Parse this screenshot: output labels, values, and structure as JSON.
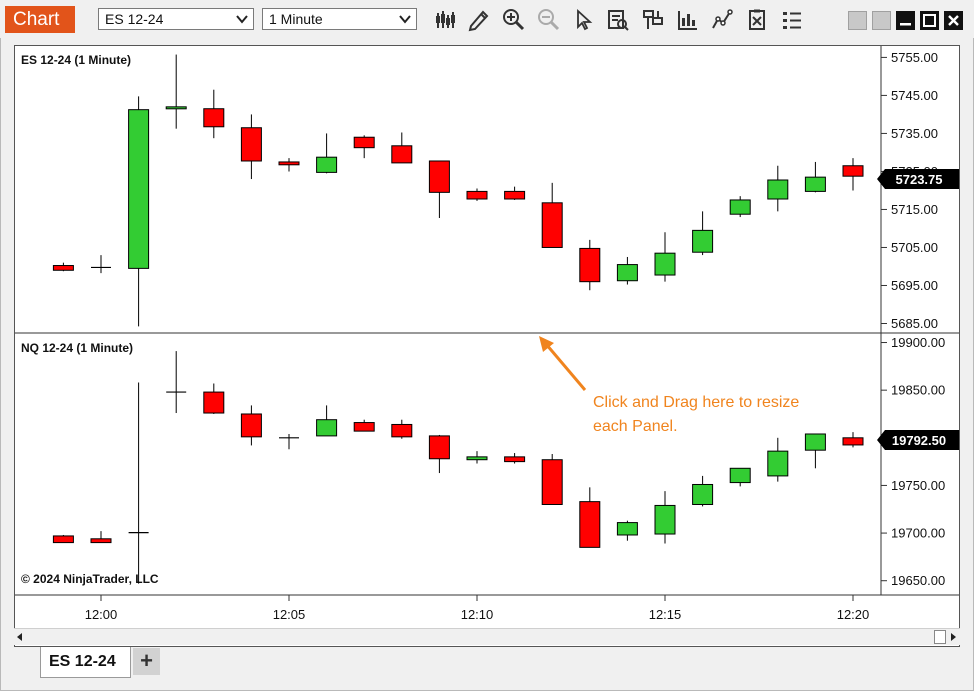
{
  "window": {
    "title": "Chart",
    "instrument": "ES 12-24",
    "interval": "1 Minute",
    "accent": "#e2541a"
  },
  "toolbar": {
    "icons": [
      "bars-type-icon",
      "draw-pencil-icon",
      "zoom-in-icon",
      "zoom-out-icon",
      "pointer-icon",
      "data-box-icon",
      "chart-trader-icon",
      "indicators-icon",
      "strategies-icon",
      "templates-icon",
      "properties-icon"
    ]
  },
  "panels": [
    {
      "label": "ES 12-24 (1 Minute)",
      "price_marker": "5723.75",
      "ticks": [
        "5755.00",
        "5745.00",
        "5735.00",
        "5725.00",
        "5715.00",
        "5705.00",
        "5695.00",
        "5685.00"
      ]
    },
    {
      "label": "NQ 12-24 (1 Minute)",
      "price_marker": "19792.50",
      "ticks": [
        "19900.00",
        "19850.00",
        "19800.00",
        "19750.00",
        "19700.00",
        "19650.00"
      ]
    }
  ],
  "copyright": "© 2024 NinjaTrader, LLC",
  "annotation": {
    "line1": "Click and Drag here to resize",
    "line2": "each Panel.",
    "color": "#f0841e"
  },
  "time_axis": [
    "12:00",
    "12:05",
    "12:10",
    "12:15",
    "12:20"
  ],
  "tabs": {
    "active": "ES 12-24",
    "add": "+"
  },
  "colors": {
    "up": "#33cc33",
    "down": "#ff0000",
    "marker_bg": "#000000"
  },
  "chart_data": [
    {
      "type": "candlestick",
      "title": "ES 12-24 (1 Minute)",
      "x": [
        "11:59",
        "12:00",
        "12:01",
        "12:02",
        "12:03",
        "12:04",
        "12:05",
        "12:06",
        "12:07",
        "12:08",
        "12:09",
        "12:10",
        "12:11",
        "12:12",
        "12:13",
        "12:14",
        "12:15",
        "12:16",
        "12:17",
        "12:18",
        "12:19",
        "12:20"
      ],
      "open": [
        5700.25,
        5699.75,
        5699.5,
        5741.5,
        5741.5,
        5736.5,
        5727.5,
        5724.75,
        5734.0,
        5731.75,
        5727.75,
        5719.75,
        5719.75,
        5716.75,
        5704.75,
        5696.25,
        5697.75,
        5703.75,
        5713.75,
        5717.75,
        5719.75,
        5726.5
      ],
      "high": [
        5701.0,
        5703.0,
        5744.75,
        5755.75,
        5746.5,
        5740.0,
        5728.5,
        5735.0,
        5734.5,
        5735.25,
        5727.75,
        5720.5,
        5721.0,
        5722.0,
        5707.0,
        5702.5,
        5709.0,
        5714.5,
        5718.5,
        5726.5,
        5727.5,
        5728.5
      ],
      "low": [
        5698.75,
        5698.25,
        5684.25,
        5736.25,
        5733.75,
        5723.0,
        5725.0,
        5724.5,
        5728.5,
        5728.0,
        5712.75,
        5717.25,
        5717.5,
        5706.75,
        5693.75,
        5695.25,
        5696.0,
        5703.0,
        5713.0,
        5714.5,
        5719.5,
        5720.0
      ],
      "close": [
        5699.0,
        5699.75,
        5741.25,
        5742.0,
        5736.75,
        5727.75,
        5726.75,
        5728.75,
        5731.25,
        5727.25,
        5719.5,
        5717.75,
        5717.75,
        5705.0,
        5696.0,
        5700.5,
        5703.5,
        5709.5,
        5717.5,
        5722.75,
        5723.5,
        5723.75
      ],
      "ylim": [
        5682.5,
        5758.0
      ]
    },
    {
      "type": "candlestick",
      "title": "NQ 12-24 (1 Minute)",
      "x": [
        "11:59",
        "12:00",
        "12:01",
        "12:02",
        "12:03",
        "12:04",
        "12:05",
        "12:06",
        "12:07",
        "12:08",
        "12:09",
        "12:10",
        "12:11",
        "12:12",
        "12:13",
        "12:14",
        "12:15",
        "12:16",
        "12:17",
        "12:18",
        "12:19",
        "12:20"
      ],
      "open": [
        19697.0,
        19694.0,
        19700.5,
        19848.0,
        19848.0,
        19825.0,
        19800.0,
        19802.0,
        19816.0,
        19814.0,
        19802.0,
        19777.0,
        19780.0,
        19777.0,
        19733.0,
        19698.0,
        19699.0,
        19730.0,
        19753.0,
        19760.0,
        19787.0,
        19800.0
      ],
      "high": [
        19698.0,
        19702.0,
        19858.0,
        19891.0,
        19857.0,
        19834.0,
        19804.0,
        19834.0,
        19819.0,
        19819.0,
        19803.0,
        19786.0,
        19784.0,
        19783.0,
        19748.0,
        19713.0,
        19744.0,
        19760.0,
        19768.0,
        19800.0,
        19804.0,
        19806.0
      ],
      "low": [
        19690.0,
        19690.0,
        19647.0,
        19826.0,
        19825.0,
        19792.0,
        19788.0,
        19803.0,
        19807.0,
        19799.0,
        19763.0,
        19773.0,
        19773.0,
        19732.0,
        19688.0,
        19692.0,
        19689.0,
        19728.0,
        19749.0,
        19754.0,
        19768.0,
        19790.0
      ],
      "close": [
        19690.0,
        19690.0,
        19700.5,
        19848.0,
        19826.0,
        19801.0,
        19800.0,
        19819.0,
        19807.0,
        19801.0,
        19778.0,
        19780.0,
        19775.0,
        19730.0,
        19685.0,
        19711.0,
        19729.0,
        19751.0,
        19768.0,
        19786.0,
        19804.0,
        19792.5
      ],
      "ylim": [
        19635.0,
        19910.0
      ]
    }
  ]
}
